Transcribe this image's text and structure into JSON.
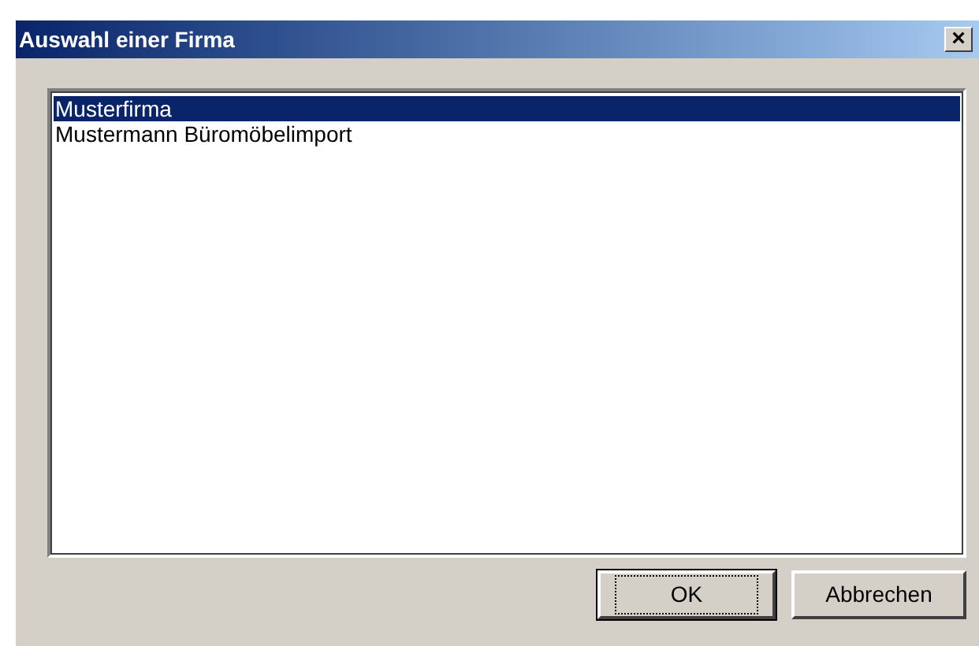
{
  "window": {
    "title": "Auswahl einer Firma",
    "close": "×"
  },
  "list": {
    "items": [
      {
        "label": "Musterfirma",
        "selected": true
      },
      {
        "label": "Mustermann Büromöbelimport",
        "selected": false
      }
    ]
  },
  "buttons": [
    {
      "label": "OK",
      "default": true
    },
    {
      "label": "Abbrechen",
      "default": false
    }
  ]
}
